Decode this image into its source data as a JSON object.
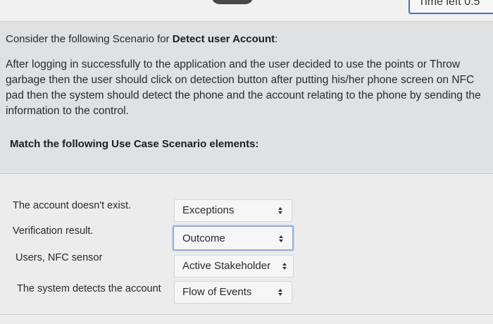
{
  "header": {
    "timer_text": "Time left 0:5"
  },
  "question": {
    "intro_prefix": "Consider the following Scenario for ",
    "intro_bold": "Detect user Account",
    "intro_suffix": ":",
    "scenario_text": "After logging in successfully to the application and the user decided to use the points or Throw garbage then the user should click on detection button after putting his/her phone screen on NFC pad then the system should detect the phone and the account relating to the phone by sending the information to the control.",
    "match_instruction": "Match the following Use Case Scenario elements:"
  },
  "matches": [
    {
      "label": "The account doesn't exist.",
      "selected": "Exceptions"
    },
    {
      "label": "Verification result.",
      "selected": "Outcome"
    },
    {
      "label": "Users, NFC sensor",
      "selected": "Active Stakeholder"
    },
    {
      "label": "The system detects the account",
      "selected": "Flow of Events"
    }
  ],
  "colors": {
    "focus_border": "#8fb0d8",
    "timer_border": "#4f6fae"
  },
  "icons": {
    "select_indicator": "up-down-chevron-icon"
  }
}
